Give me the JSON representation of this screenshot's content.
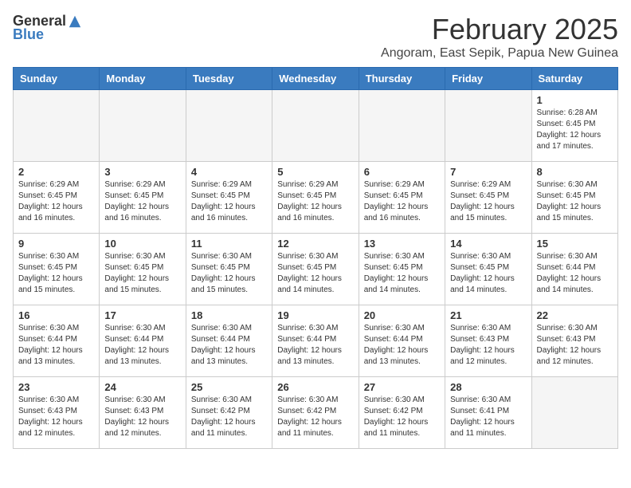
{
  "logo": {
    "general": "General",
    "blue": "Blue"
  },
  "title": "February 2025",
  "location": "Angoram, East Sepik, Papua New Guinea",
  "days_of_week": [
    "Sunday",
    "Monday",
    "Tuesday",
    "Wednesday",
    "Thursday",
    "Friday",
    "Saturday"
  ],
  "weeks": [
    [
      {
        "day": "",
        "info": ""
      },
      {
        "day": "",
        "info": ""
      },
      {
        "day": "",
        "info": ""
      },
      {
        "day": "",
        "info": ""
      },
      {
        "day": "",
        "info": ""
      },
      {
        "day": "",
        "info": ""
      },
      {
        "day": "1",
        "info": "Sunrise: 6:28 AM\nSunset: 6:45 PM\nDaylight: 12 hours and 17 minutes."
      }
    ],
    [
      {
        "day": "2",
        "info": "Sunrise: 6:29 AM\nSunset: 6:45 PM\nDaylight: 12 hours and 16 minutes."
      },
      {
        "day": "3",
        "info": "Sunrise: 6:29 AM\nSunset: 6:45 PM\nDaylight: 12 hours and 16 minutes."
      },
      {
        "day": "4",
        "info": "Sunrise: 6:29 AM\nSunset: 6:45 PM\nDaylight: 12 hours and 16 minutes."
      },
      {
        "day": "5",
        "info": "Sunrise: 6:29 AM\nSunset: 6:45 PM\nDaylight: 12 hours and 16 minutes."
      },
      {
        "day": "6",
        "info": "Sunrise: 6:29 AM\nSunset: 6:45 PM\nDaylight: 12 hours and 16 minutes."
      },
      {
        "day": "7",
        "info": "Sunrise: 6:29 AM\nSunset: 6:45 PM\nDaylight: 12 hours and 15 minutes."
      },
      {
        "day": "8",
        "info": "Sunrise: 6:30 AM\nSunset: 6:45 PM\nDaylight: 12 hours and 15 minutes."
      }
    ],
    [
      {
        "day": "9",
        "info": "Sunrise: 6:30 AM\nSunset: 6:45 PM\nDaylight: 12 hours and 15 minutes."
      },
      {
        "day": "10",
        "info": "Sunrise: 6:30 AM\nSunset: 6:45 PM\nDaylight: 12 hours and 15 minutes."
      },
      {
        "day": "11",
        "info": "Sunrise: 6:30 AM\nSunset: 6:45 PM\nDaylight: 12 hours and 15 minutes."
      },
      {
        "day": "12",
        "info": "Sunrise: 6:30 AM\nSunset: 6:45 PM\nDaylight: 12 hours and 14 minutes."
      },
      {
        "day": "13",
        "info": "Sunrise: 6:30 AM\nSunset: 6:45 PM\nDaylight: 12 hours and 14 minutes."
      },
      {
        "day": "14",
        "info": "Sunrise: 6:30 AM\nSunset: 6:45 PM\nDaylight: 12 hours and 14 minutes."
      },
      {
        "day": "15",
        "info": "Sunrise: 6:30 AM\nSunset: 6:44 PM\nDaylight: 12 hours and 14 minutes."
      }
    ],
    [
      {
        "day": "16",
        "info": "Sunrise: 6:30 AM\nSunset: 6:44 PM\nDaylight: 12 hours and 13 minutes."
      },
      {
        "day": "17",
        "info": "Sunrise: 6:30 AM\nSunset: 6:44 PM\nDaylight: 12 hours and 13 minutes."
      },
      {
        "day": "18",
        "info": "Sunrise: 6:30 AM\nSunset: 6:44 PM\nDaylight: 12 hours and 13 minutes."
      },
      {
        "day": "19",
        "info": "Sunrise: 6:30 AM\nSunset: 6:44 PM\nDaylight: 12 hours and 13 minutes."
      },
      {
        "day": "20",
        "info": "Sunrise: 6:30 AM\nSunset: 6:44 PM\nDaylight: 12 hours and 13 minutes."
      },
      {
        "day": "21",
        "info": "Sunrise: 6:30 AM\nSunset: 6:43 PM\nDaylight: 12 hours and 12 minutes."
      },
      {
        "day": "22",
        "info": "Sunrise: 6:30 AM\nSunset: 6:43 PM\nDaylight: 12 hours and 12 minutes."
      }
    ],
    [
      {
        "day": "23",
        "info": "Sunrise: 6:30 AM\nSunset: 6:43 PM\nDaylight: 12 hours and 12 minutes."
      },
      {
        "day": "24",
        "info": "Sunrise: 6:30 AM\nSunset: 6:43 PM\nDaylight: 12 hours and 12 minutes."
      },
      {
        "day": "25",
        "info": "Sunrise: 6:30 AM\nSunset: 6:42 PM\nDaylight: 12 hours and 11 minutes."
      },
      {
        "day": "26",
        "info": "Sunrise: 6:30 AM\nSunset: 6:42 PM\nDaylight: 12 hours and 11 minutes."
      },
      {
        "day": "27",
        "info": "Sunrise: 6:30 AM\nSunset: 6:42 PM\nDaylight: 12 hours and 11 minutes."
      },
      {
        "day": "28",
        "info": "Sunrise: 6:30 AM\nSunset: 6:41 PM\nDaylight: 12 hours and 11 minutes."
      },
      {
        "day": "",
        "info": ""
      }
    ]
  ]
}
